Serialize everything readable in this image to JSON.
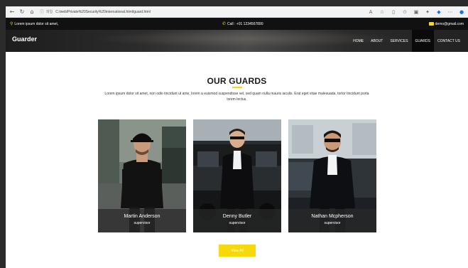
{
  "browser": {
    "info_icon": "info-icon",
    "security_label": "파일",
    "url": "C:/web/Private%20Security%20international.html/guard.html"
  },
  "topbar": {
    "address": "Lorem ipsum dolor sit amet,",
    "phone": "Call : +01 1234567890",
    "email": "demo@gmail.com"
  },
  "nav": {
    "brand": "Guarder",
    "items": [
      {
        "label": "HOME",
        "active": false
      },
      {
        "label": "ABOUT",
        "active": false
      },
      {
        "label": "SERVICES",
        "active": false
      },
      {
        "label": "GUARDS",
        "active": true
      },
      {
        "label": "CONTACT US",
        "active": false
      }
    ]
  },
  "section": {
    "title": "OUR GUARDS",
    "description": "Lorem ipsum dolor sit amet, non odio tincidunt ut ante, lorem a euismod suspendisse vel, sed quam nulla mauris iaculis. Erat eget vitae malesuada, tortor tincidunt porta lorem lectus."
  },
  "guards": [
    {
      "name": "Martin Anderson",
      "role": "supervisor"
    },
    {
      "name": "Denny Butler",
      "role": "supervisor"
    },
    {
      "name": "Nathan Mcpherson",
      "role": "supervisor"
    }
  ],
  "view_all_label": "View All",
  "colors": {
    "accent": "#f5d90a",
    "topbar_bg": "#111111",
    "active_nav_bg": "#0a0a0a"
  }
}
